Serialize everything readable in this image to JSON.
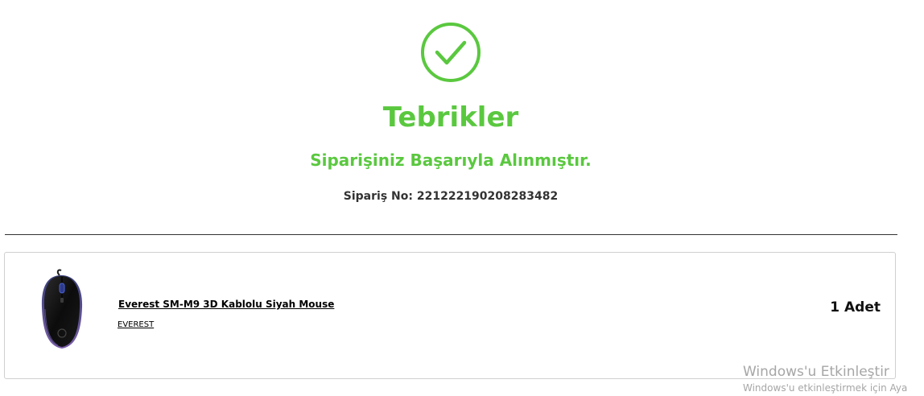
{
  "success": {
    "icon": "check-circle-icon",
    "title": "Tebrikler",
    "subtitle": "Siparişiniz Başarıyla Alınmıştır.",
    "order_label": "Sipariş No:",
    "order_number": "221222190208283482"
  },
  "colors": {
    "success_green": "#5ac83f",
    "divider": "#333333",
    "card_border": "#cfcfcf"
  },
  "order_items": [
    {
      "image_icon": "mouse-product-image",
      "name": "Everest SM-M9 3D Kablolu Siyah Mouse",
      "brand": "EVEREST",
      "quantity": "1 Adet"
    }
  ],
  "watermark": {
    "title": "Windows'u Etkinleştir",
    "subtitle": "Windows'u etkinleştirmek için Aya"
  }
}
